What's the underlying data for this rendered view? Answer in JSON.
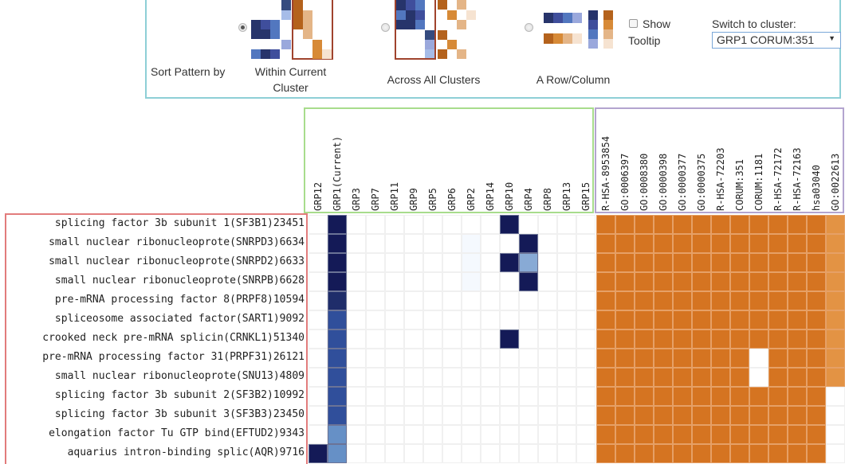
{
  "controls": {
    "sort_label": "Sort Pattern by",
    "options": [
      {
        "label_line1": "Within Current",
        "label_line2": "Cluster",
        "checked": true
      },
      {
        "label_line1": "Across All Clusters",
        "label_line2": "",
        "checked": false
      },
      {
        "label_line1": "A Row/Column",
        "label_line2": "",
        "checked": false
      }
    ],
    "tooltip_checkbox": {
      "label_line1": "Show",
      "label_line2": "Tooltip",
      "checked": false
    },
    "switch_label": "Switch to cluster:",
    "switch_value": "GRP1 CORUM:351",
    "dropdown_icon": "triangle-down-icon"
  },
  "colors": {
    "blue_dark": "#141a57",
    "blue_low": "#f5f9fe",
    "orange_full": "#d57421",
    "orange_light": "#e39344",
    "grid_line": "#f0f0f0",
    "panel_border": "#8ecfd6",
    "cluster_box_border": "#a8dc8c",
    "term_box_border": "#b3a4cf",
    "gene_box_border": "#e27c7c"
  },
  "chart_data": {
    "type": "heatmap",
    "rows": [
      "splicing factor 3b subunit 1(SF3B1)23451",
      "small nuclear ribonucleoprote(SNRPD3)6634",
      "small nuclear ribonucleoprote(SNRPD2)6633",
      "small nuclear ribonucleoprote(SNRPB)6628",
      "pre-mRNA processing factor 8(PRPF8)10594",
      "spliceosome associated factor(SART1)9092",
      "crooked neck pre-mRNA splicin(CRNKL1)51340",
      "pre-mRNA processing factor 31(PRPF31)26121",
      "small nuclear ribonucleoprote(SNU13)4809",
      "splicing factor 3b subunit 2(SF3B2)10992",
      "splicing factor 3b subunit 3(SF3B3)23450",
      "elongation factor Tu GTP bind(EFTUD2)9343",
      "aquarius intron-binding splic(AQR)9716"
    ],
    "cluster_columns": [
      "GRP12",
      "GRP1(Current)",
      "GRP3",
      "GRP7",
      "GRP11",
      "GRP9",
      "GRP5",
      "GRP6",
      "GRP2",
      "GRP14",
      "GRP10",
      "GRP4",
      "GRP8",
      "GRP13",
      "GRP15"
    ],
    "cluster_values": [
      [
        0,
        1,
        0,
        0,
        0,
        0,
        0,
        0,
        0,
        0,
        1,
        0,
        0,
        0,
        0
      ],
      [
        0,
        1,
        0,
        0,
        0,
        0,
        0,
        0,
        0.03,
        0,
        0,
        1,
        0,
        0,
        0
      ],
      [
        0,
        1,
        0,
        0,
        0,
        0,
        0,
        0,
        0.03,
        0,
        1,
        0.45,
        0,
        0,
        0
      ],
      [
        0,
        1,
        0,
        0,
        0,
        0,
        0,
        0,
        0.03,
        0,
        0,
        1,
        0,
        0,
        0
      ],
      [
        0,
        0.9,
        0,
        0,
        0,
        0,
        0,
        0,
        0,
        0,
        0,
        0,
        0,
        0,
        0
      ],
      [
        0,
        0.75,
        0,
        0,
        0,
        0,
        0,
        0,
        0,
        0,
        0,
        0,
        0,
        0,
        0
      ],
      [
        0,
        0.75,
        0,
        0,
        0,
        0,
        0,
        0,
        0,
        0,
        1,
        0,
        0,
        0,
        0
      ],
      [
        0,
        0.75,
        0,
        0,
        0,
        0,
        0,
        0,
        0,
        0,
        0,
        0,
        0,
        0,
        0
      ],
      [
        0,
        0.75,
        0,
        0,
        0,
        0,
        0,
        0,
        0,
        0,
        0,
        0,
        0,
        0,
        0
      ],
      [
        0,
        0.75,
        0,
        0,
        0,
        0,
        0,
        0,
        0,
        0,
        0,
        0,
        0,
        0,
        0
      ],
      [
        0,
        0.75,
        0,
        0,
        0,
        0,
        0,
        0,
        0,
        0,
        0,
        0,
        0,
        0,
        0
      ],
      [
        0,
        0.5,
        0,
        0,
        0,
        0,
        0,
        0,
        0,
        0,
        0,
        0,
        0,
        0,
        0
      ],
      [
        1,
        0.5,
        0,
        0,
        0,
        0,
        0,
        0,
        0,
        0,
        0,
        0,
        0,
        0,
        0
      ]
    ],
    "term_columns": [
      "R-HSA-8953854",
      "GO:0006397",
      "GO:0008380",
      "GO:0000398",
      "GO:0000377",
      "GO:0000375",
      "R-HSA-72203",
      "CORUM:351",
      "CORUM:1181",
      "R-HSA-72172",
      "R-HSA-72163",
      "hsa03040",
      "GO:0022613"
    ],
    "term_values": [
      [
        1,
        1,
        1,
        1,
        1,
        1,
        1,
        1,
        1,
        1,
        1,
        1,
        0.8
      ],
      [
        1,
        1,
        1,
        1,
        1,
        1,
        1,
        1,
        1,
        1,
        1,
        1,
        0.8
      ],
      [
        1,
        1,
        1,
        1,
        1,
        1,
        1,
        1,
        1,
        1,
        1,
        1,
        0.8
      ],
      [
        1,
        1,
        1,
        1,
        1,
        1,
        1,
        1,
        1,
        1,
        1,
        1,
        0.8
      ],
      [
        1,
        1,
        1,
        1,
        1,
        1,
        1,
        1,
        1,
        1,
        1,
        1,
        0.8
      ],
      [
        1,
        1,
        1,
        1,
        1,
        1,
        1,
        1,
        1,
        1,
        1,
        1,
        0.8
      ],
      [
        1,
        1,
        1,
        1,
        1,
        1,
        1,
        1,
        1,
        1,
        1,
        1,
        0.8
      ],
      [
        1,
        1,
        1,
        1,
        1,
        1,
        1,
        1,
        0,
        1,
        1,
        1,
        0.8
      ],
      [
        1,
        1,
        1,
        1,
        1,
        1,
        1,
        1,
        0,
        1,
        1,
        1,
        0.8
      ],
      [
        1,
        1,
        1,
        1,
        1,
        1,
        1,
        1,
        1,
        1,
        1,
        1,
        0
      ],
      [
        1,
        1,
        1,
        1,
        1,
        1,
        1,
        1,
        1,
        1,
        1,
        1,
        0
      ],
      [
        1,
        1,
        1,
        1,
        1,
        1,
        1,
        1,
        1,
        1,
        1,
        1,
        0
      ],
      [
        1,
        1,
        1,
        1,
        1,
        1,
        1,
        1,
        1,
        1,
        1,
        1,
        0
      ]
    ],
    "value_range": [
      0,
      1
    ]
  }
}
